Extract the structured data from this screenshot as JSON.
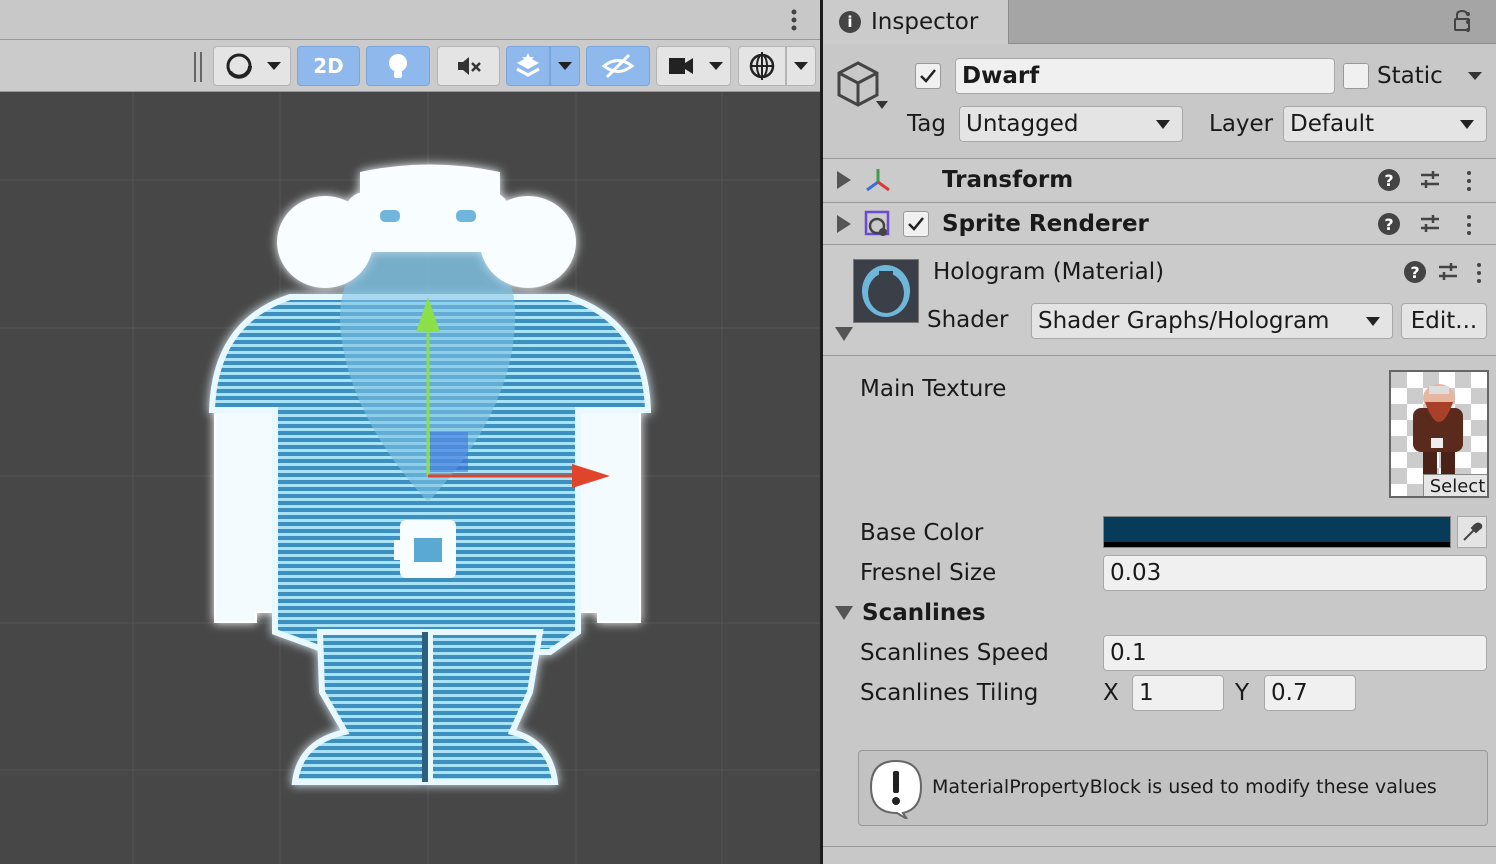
{
  "inspector": {
    "tab_title": "Inspector",
    "object": {
      "name": "Dwarf",
      "enabled": true,
      "static_label": "Static",
      "tag_label": "Tag",
      "tag_value": "Untagged",
      "layer_label": "Layer",
      "layer_value": "Default"
    },
    "components": [
      {
        "label": "Transform",
        "icon": "transform-axes-icon"
      },
      {
        "label": "Sprite Renderer",
        "icon": "sprite-renderer-icon",
        "enabled": true
      }
    ],
    "material": {
      "title": "Hologram (Material)",
      "shader_label": "Shader",
      "shader_value": "Shader Graphs/Hologram",
      "edit_label": "Edit..."
    },
    "properties": {
      "main_texture_label": "Main Texture",
      "select_label": "Select",
      "base_color_label": "Base Color",
      "base_color": "#063b5a",
      "fresnel_label": "Fresnel Size",
      "fresnel_value": "0.03",
      "scanlines_header": "Scanlines",
      "scanlines_speed_label": "Scanlines Speed",
      "scanlines_speed_value": "0.1",
      "scanlines_tiling_label": "Scanlines Tiling",
      "tiling_x_label": "X",
      "tiling_x_value": "1",
      "tiling_y_label": "Y",
      "tiling_y_value": "0.7"
    },
    "help_box": "MaterialPropertyBlock is used to modify these values"
  },
  "scene_toolbar": {
    "mode_2d_label": "2D",
    "mode_2d_active": true,
    "lighting_active": true,
    "gizmo_move_active": true,
    "visibility_active": true
  },
  "colors": {
    "scene_bg": "#474747",
    "active_toggle": "#8fb9ec",
    "hologram": "#4fa8d8",
    "x_axis": "#e0442a",
    "y_axis": "#8be04a"
  }
}
